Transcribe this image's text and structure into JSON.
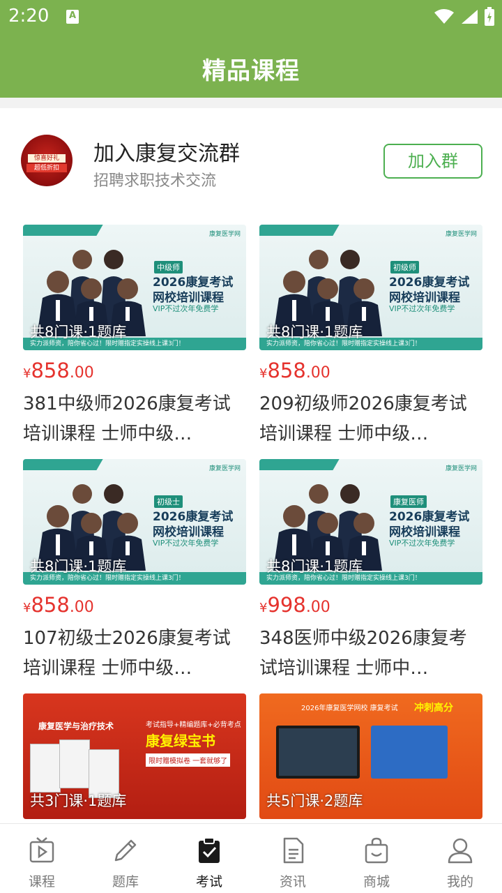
{
  "status_bar": {
    "time": "2:20",
    "notif_icon": "A"
  },
  "app_bar": {
    "title": "精品课程"
  },
  "group": {
    "avatar_text_1": "惊喜好礼",
    "avatar_text_2": "超低折扣",
    "title": "加入康复交流群",
    "subtitle": "招聘求职技术交流",
    "button": "加入群"
  },
  "courses": [
    {
      "badge": "中级师",
      "thumb_line1": "2026康复考试",
      "thumb_line2": "网校培训课程",
      "thumb_vip": "VIP不过次年免费学",
      "thumb_brand": "康复医学网",
      "thumb_bottom": "实力派师资，陪你省心过！限时赠指定实操线上课3门！",
      "count": "共8门课·1题库",
      "yen": "¥",
      "price_int": "858",
      "price_dec": ".00",
      "title": "381中级师2026康复考试培训课程 士师中级…"
    },
    {
      "badge": "初级师",
      "thumb_line1": "2026康复考试",
      "thumb_line2": "网校培训课程",
      "thumb_vip": "VIP不过次年免费学",
      "thumb_brand": "康复医学网",
      "thumb_bottom": "实力派师资，陪你省心过！限时赠指定实操线上课3门！",
      "count": "共8门课·1题库",
      "yen": "¥",
      "price_int": "858",
      "price_dec": ".00",
      "title": "209初级师2026康复考试培训课程 士师中级…"
    },
    {
      "badge": "初级士",
      "thumb_line1": "2026康复考试",
      "thumb_line2": "网校培训课程",
      "thumb_vip": "VIP不过次年免费学",
      "thumb_brand": "康复医学网",
      "thumb_bottom": "实力派师资，陪你省心过！限时赠指定实操线上课3门！",
      "count": "共8门课·1题库",
      "yen": "¥",
      "price_int": "858",
      "price_dec": ".00",
      "title": "107初级士2026康复考试培训课程 士师中级…"
    },
    {
      "badge": "康复医师",
      "thumb_line1": "2026康复考试",
      "thumb_line2": "网校培训课程",
      "thumb_vip": "VIP不过次年免费学",
      "thumb_brand": "康复医学网",
      "thumb_bottom": "实力派师资，陪你省心过！限时赠指定实操线上课3门！",
      "count": "共8门课·1题库",
      "yen": "¥",
      "price_int": "998",
      "price_dec": ".00",
      "title": "348医师中级2026康复考试培训课程 士师中…"
    },
    {
      "thumb_title": "康复医学与治疗技术",
      "thumb_line": "考试指导+精编题库+必背考点",
      "thumb_big": "康复绿宝书",
      "thumb_box": "限时赠模拟卷 一套就够了",
      "count": "共3门课·1题库"
    },
    {
      "thumb_title": "2026年康复医学网校 康复考试",
      "thumb_hl": "冲刺高分",
      "count": "共5门课·2题库"
    }
  ],
  "tabs": [
    {
      "label": "课程",
      "icon": "course-icon"
    },
    {
      "label": "题库",
      "icon": "pencil-icon"
    },
    {
      "label": "考试",
      "icon": "clipboard-check-icon",
      "active": true
    },
    {
      "label": "资讯",
      "icon": "document-icon"
    },
    {
      "label": "商城",
      "icon": "shopping-bag-icon"
    },
    {
      "label": "我的",
      "icon": "user-icon"
    }
  ],
  "colors": {
    "primary": "#7cb24f",
    "accent_green": "#4caf50",
    "price_red": "#e5322d"
  }
}
